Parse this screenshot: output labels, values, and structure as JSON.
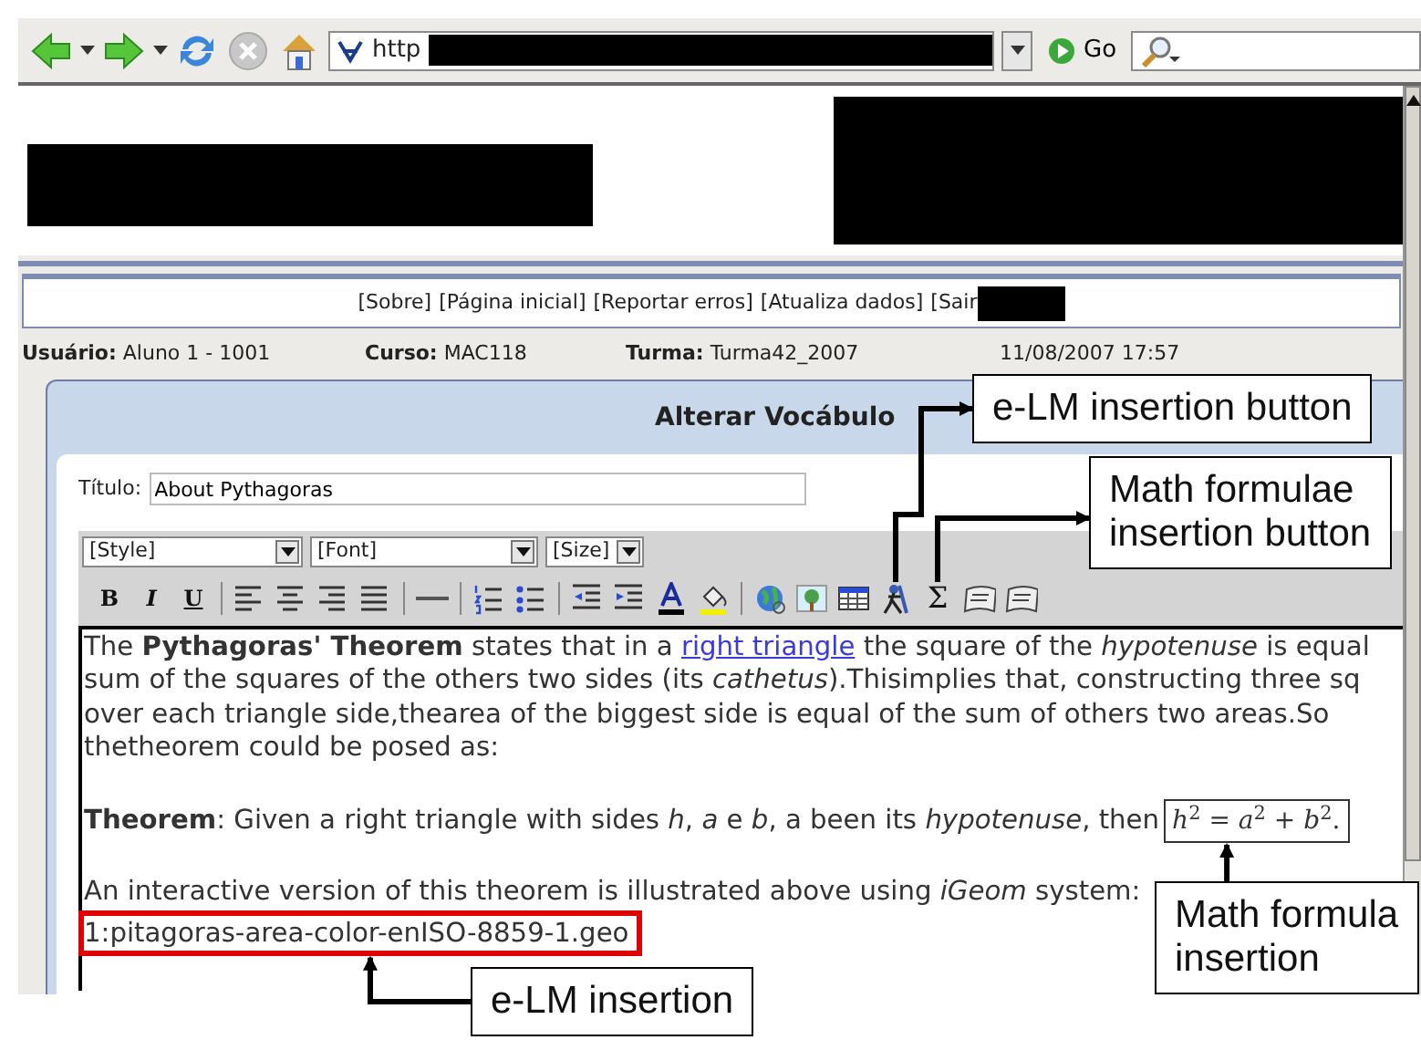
{
  "browser": {
    "url": "http",
    "go": "Go"
  },
  "nav_links": [
    "[Sobre]",
    "[Página inicial]",
    "[Reportar erros]",
    "[Atualiza dados]",
    "[Sair"
  ],
  "info": [
    {
      "label": "Usuário:",
      "value": "Aluno 1 - 1001"
    },
    {
      "label": "Curso:",
      "value": "MAC118"
    },
    {
      "label": "Turma:",
      "value": "Turma42_2007"
    },
    {
      "value": "11/08/2007 17:57"
    }
  ],
  "panel": {
    "title": "Alterar Vocábulo"
  },
  "form": {
    "label": "Título:",
    "value": "About Pythagoras"
  },
  "selects": [
    "[Style]",
    "[Font]",
    "[Size]"
  ],
  "toolbar": [
    [
      {
        "kind": "letter",
        "text": "B"
      },
      {
        "kind": "letter",
        "text": "I"
      },
      {
        "kind": "letter",
        "text": "U"
      }
    ],
    [
      {
        "kind": "alignleft"
      },
      {
        "kind": "aligncenter"
      },
      {
        "kind": "alignright"
      },
      {
        "kind": "justify"
      }
    ],
    [
      {
        "kind": "rule"
      }
    ],
    [
      {
        "kind": "ordered"
      },
      {
        "kind": "unordered"
      }
    ],
    [
      {
        "kind": "outdent"
      },
      {
        "kind": "indent"
      },
      {
        "kind": "fontcolor"
      },
      {
        "kind": "highlight"
      }
    ],
    [
      {
        "kind": "globe"
      },
      {
        "kind": "image"
      },
      {
        "kind": "table"
      },
      {
        "kind": "figures"
      },
      {
        "kind": "glyph",
        "text": "Σ"
      },
      {
        "kind": "scroll"
      },
      {
        "kind": "scroll"
      }
    ]
  ],
  "content": [
    [
      {
        "kind": "text",
        "text": "The **Pythagoras' Theorem** states that in a "
      },
      {
        "kind": "link",
        "text": "right triangle"
      },
      {
        "kind": "text",
        "text": " the square of the *hypotenuse* is equal\nsum of the squares of the others two sides (its *cathetus*).Thisimplies that, constructing three sq\nover each triangle side,thearea of the biggest side is equal of the sum of others two areas.So\nthetheorem could be posed as:"
      }
    ],
    [
      {
        "kind": "text",
        "text": "**Theorem**: Given a right triangle with sides *h*, *a* e *b*, a been its *hypotenuse*, then"
      },
      {
        "kind": "formula",
        "text": "*h*$^{2}$ = *a*$^{2}$ + *b*$^{2}$."
      }
    ],
    [
      {
        "kind": "text",
        "text": "An interactive version of this theorem is illustrated above using *iGeom* system:\n"
      },
      {
        "kind": "file",
        "text": "1:pitagoras-area-color-enISO-8859-1.geo"
      }
    ]
  ],
  "callouts": [
    {
      "kind": "elm-button",
      "text": "e-LM insertion button"
    },
    {
      "kind": "math-button",
      "text": "Math formulae\ninsertion button"
    },
    {
      "kind": "math-insert",
      "text": "Math formula\ninsertion"
    },
    {
      "kind": "elm-insert",
      "text": "e-LM insertion"
    }
  ]
}
